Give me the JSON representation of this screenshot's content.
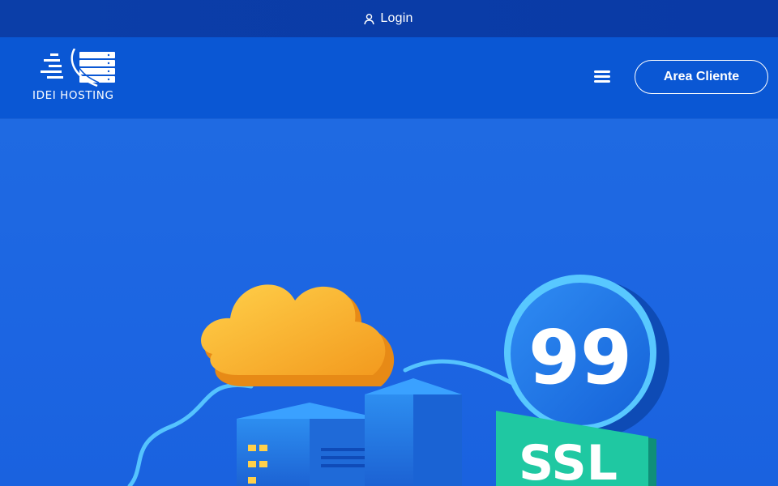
{
  "topbar": {
    "login_label": "Login"
  },
  "header": {
    "logo_text": "IDEI HOSTING",
    "cta_label": "Area Cliente"
  },
  "hero": {
    "uptime_badge": "99",
    "ssl_badge": "SSL"
  },
  "colors": {
    "topbar": "#0b3ea8",
    "header": "#0a57d4",
    "hero": "#1f6ae2",
    "cloud": "#f7ad2b",
    "badge": "#1f7be8",
    "ssl": "#1fc8a2"
  }
}
